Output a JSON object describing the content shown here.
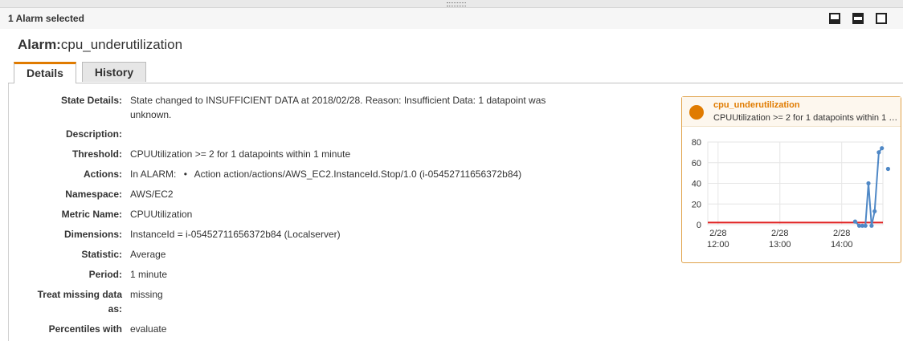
{
  "header": {
    "selected_text": "1 Alarm selected"
  },
  "alarm": {
    "prefix": "Alarm:",
    "name": "cpu_underutilization"
  },
  "tabs": [
    {
      "label": "Details",
      "active": true
    },
    {
      "label": "History",
      "active": false
    }
  ],
  "details": {
    "rows": [
      {
        "label": "State Details:",
        "value": "State changed to INSUFFICIENT DATA at 2018/02/28. Reason: Insufficient Data: 1 datapoint was",
        "value2": "unknown."
      },
      {
        "label": "Description:",
        "value": ""
      },
      {
        "label": "Threshold:",
        "value": "CPUUtilization >= 2 for 1 datapoints within 1 minute"
      },
      {
        "label": "Actions:",
        "value": "In ALARM:",
        "bullet": "•",
        "value2": "Action action/actions/AWS_EC2.InstanceId.Stop/1.0 (i-05452711656372b84)"
      },
      {
        "label": "Namespace:",
        "value": "AWS/EC2"
      },
      {
        "label": "Metric Name:",
        "value": "CPUUtilization"
      },
      {
        "label": "Dimensions:",
        "value": "InstanceId = i-05452711656372b84 (Localserver)"
      },
      {
        "label": "Statistic:",
        "value": "Average"
      },
      {
        "label": "Period:",
        "value": "1 minute"
      },
      {
        "label": "Treat missing data",
        "label2": "as:",
        "value": "missing"
      },
      {
        "label": "Percentiles with",
        "value": "evaluate"
      }
    ]
  },
  "chart_panel": {
    "title": "cpu_underutilization",
    "subtitle": "CPUUtilization >= 2 for 1 datapoints within 1 …",
    "status_color": "#e07b00"
  },
  "chart_data": {
    "type": "line",
    "title": "cpu_underutilization",
    "ylim": [
      0,
      80
    ],
    "yticks": [
      0,
      20,
      40,
      60,
      80
    ],
    "xticks": [
      {
        "t": 720,
        "l1": "2/28",
        "l2": "12:00"
      },
      {
        "t": 780,
        "l1": "2/28",
        "l2": "13:00"
      },
      {
        "t": 840,
        "l1": "2/28",
        "l2": "14:00"
      }
    ],
    "xlim": [
      710,
      880
    ],
    "threshold": 2,
    "threshold_color": "#e02020",
    "series_color": "#4f88c6",
    "points": [
      [
        853,
        3
      ],
      [
        857,
        -1
      ],
      [
        860,
        -1
      ],
      [
        863,
        -1
      ],
      [
        866,
        40
      ],
      [
        869,
        -1
      ],
      [
        872,
        13
      ],
      [
        876,
        70
      ],
      [
        879,
        74
      ],
      [
        885,
        54
      ]
    ],
    "grid": true
  }
}
